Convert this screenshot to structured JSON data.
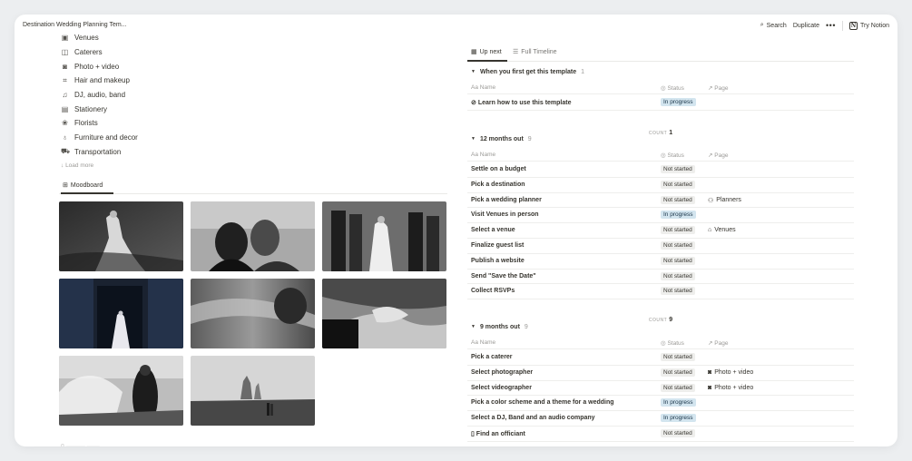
{
  "topbar": {
    "title": "Destination Wedding Planning Tem...",
    "search_label": "Search",
    "duplicate_label": "Duplicate",
    "more_label": "•••",
    "try_notion_label": "Try Notion"
  },
  "vendor_list": [
    {
      "label": "Venues",
      "icon": "venue-icon",
      "glyph": "▣"
    },
    {
      "label": "Caterers",
      "icon": "caterer-icon",
      "glyph": "◫"
    },
    {
      "label": "Photo + video",
      "icon": "camera-icon",
      "glyph": "◙"
    },
    {
      "label": "Hair and makeup",
      "icon": "crop-icon",
      "glyph": "⌗"
    },
    {
      "label": "DJ, audio, band",
      "icon": "music-icon",
      "glyph": "♫"
    },
    {
      "label": "Stationery",
      "icon": "stationery-icon",
      "glyph": "▤"
    },
    {
      "label": "Florists",
      "icon": "flower-icon",
      "glyph": "❀"
    },
    {
      "label": "Furniture and decor",
      "icon": "lamp-icon",
      "glyph": "♁"
    },
    {
      "label": "Transportation",
      "icon": "truck-icon",
      "glyph": "⛟"
    }
  ],
  "load_more": "Load more",
  "moodboard": {
    "tab_label": "Moodboard"
  },
  "timeline": {
    "tabs": {
      "up_next": "Up next",
      "full_timeline": "Full Timeline"
    },
    "columns": {
      "name": "Name",
      "status": "Status",
      "page": "Page"
    },
    "count_label": "COUNT",
    "groups": [
      {
        "title": "When you first get this template",
        "count": "1",
        "rows": [
          {
            "name": "Learn how to use this template",
            "status": "In progress",
            "page": ""
          }
        ]
      },
      {
        "title": "12 months out",
        "count": "9",
        "rows": [
          {
            "name": "Settle on a budget",
            "status": "Not started",
            "page": ""
          },
          {
            "name": "Pick a destination",
            "status": "Not started",
            "page": ""
          },
          {
            "name": "Pick a wedding planner",
            "status": "Not started",
            "page": "Planners"
          },
          {
            "name": "Visit Venues in person",
            "status": "In progress",
            "page": ""
          },
          {
            "name": "Select a venue",
            "status": "Not started",
            "page": "Venues"
          },
          {
            "name": "Finalize guest list",
            "status": "Not started",
            "page": ""
          },
          {
            "name": "Publish a website",
            "status": "Not started",
            "page": ""
          },
          {
            "name": "Send \"Save the Date\"",
            "status": "Not started",
            "page": ""
          },
          {
            "name": "Collect RSVPs",
            "status": "Not started",
            "page": ""
          }
        ]
      },
      {
        "title": "9 months out",
        "count": "9",
        "rows": [
          {
            "name": "Pick a caterer",
            "status": "Not started",
            "page": ""
          },
          {
            "name": "Select photographer",
            "status": "Not started",
            "page": "Photo + video"
          },
          {
            "name": "Select videographer",
            "status": "Not started",
            "page": "Photo + video"
          },
          {
            "name": "Pick a color scheme and a theme for a wedding",
            "status": "In progress",
            "page": ""
          },
          {
            "name": "Select a DJ, Band and an audio company",
            "status": "In progress",
            "page": ""
          },
          {
            "name": "Find an officiant",
            "status": "Not started",
            "page": ""
          }
        ],
        "footer_count": "9"
      }
    ]
  }
}
